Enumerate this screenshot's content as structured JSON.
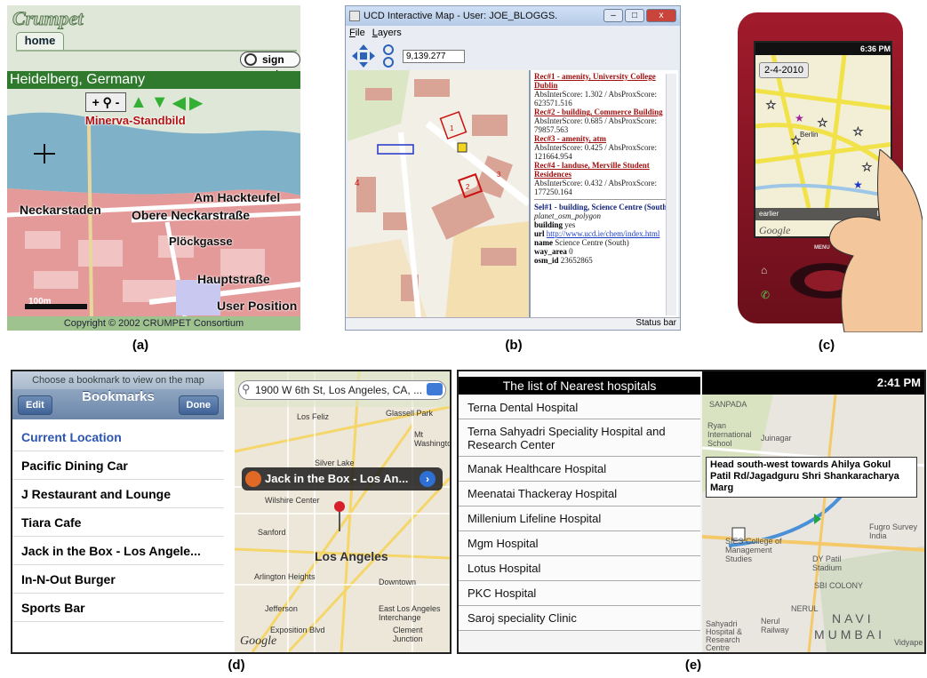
{
  "captions": {
    "a": "(a)",
    "b": "(b)",
    "c": "(c)",
    "d": "(d)",
    "e": "(e)"
  },
  "panel_a": {
    "logo": "Crumpet",
    "tab": "home",
    "sign_out": "sign out",
    "city": "Heidelberg, Germany",
    "poi": "Minerva-Standbild",
    "streets": [
      "Am Hackteufel",
      "Neckarstaden",
      "Obere Neckarstraße",
      "Plöckgasse",
      "Hauptstraße"
    ],
    "scale": "100m",
    "user_position": "User Position",
    "copyright": "Copyright © 2002 CRUMPET Consortium"
  },
  "panel_b": {
    "title": "UCD Interactive Map - User: JOE_BLOGGS.",
    "menu": [
      "File",
      "Layers"
    ],
    "scale_value": "9,139.277",
    "map_markers": [
      "1",
      "2",
      "3",
      "4"
    ],
    "records": [
      {
        "label": "Rec#1 - amenity, University College Dublin",
        "score": "AbsInterScore: 1.302 / AbsProxScore: 623571.516"
      },
      {
        "label": "Rec#2 - building, Commerce Building",
        "score": "AbsInterScore: 0.685 / AbsProxScore: 79857.563"
      },
      {
        "label": "Rec#3 - amenity, atm",
        "score": "AbsInterScore: 0.425 / AbsProxScore: 121664.954"
      },
      {
        "label": "Rec#4 - landuse, Merville Student Residences",
        "score": "AbsInterScore: 0.432 / AbsProxScore: 177250.164"
      }
    ],
    "selection": {
      "label": "Sel#1 - building, Science Centre (South)",
      "table": "planet_osm_polygon",
      "building_key": "building",
      "building_val": "yes",
      "url_key": "url",
      "url_val": "http://www.ucd.ie/chem/index.html",
      "name_key": "name",
      "name_val": "Science Centre (South)",
      "way_key": "way_area",
      "way_val": "0",
      "osm_key": "osm_id",
      "osm_val": "23652865"
    },
    "status": "Status bar"
  },
  "panel_c": {
    "time": "6:36 PM",
    "date": "2-4-2010",
    "city": "Berlin",
    "earlier": "earlier",
    "later": "later",
    "google": "Google",
    "menu": "MENU"
  },
  "panel_d": {
    "hint": "Choose a bookmark to view on the map",
    "edit": "Edit",
    "title": "Bookmarks",
    "done": "Done",
    "bookmarks": [
      "Current Location",
      "Pacific Dining Car",
      "J Restaurant and Lounge",
      "Tiara Cafe",
      "Jack in the Box - Los Angele...",
      "In-N-Out Burger",
      "Sports Bar"
    ],
    "search": "1900 W 6th St, Los Angeles, CA, ...",
    "callout": "Jack in the Box - Los An...",
    "city": "Los Angeles",
    "map_labels": [
      "Los Feliz",
      "Glassell Park",
      "Mt Washington",
      "Silver Lake",
      "Wilshire Center",
      "Sanford",
      "Arlington Heights",
      "Downtown",
      "Jefferson",
      "East Los Angeles Interchange",
      "Exposition Blvd",
      "Clement Junction",
      "Google"
    ]
  },
  "panel_e": {
    "header": "The list of Nearest hospitals",
    "time": "2:41 PM",
    "hospitals": [
      "Terna Dental Hospital",
      "Terna Sahyadri Speciality Hospital and Research Center",
      "Manak Healthcare Hospital",
      "Meenatai Thackeray Hospital",
      "Millenium Lifeline Hospital",
      "Mgm Hospital",
      "Lotus Hospital",
      "PKC Hospital",
      "Saroj speciality Clinic"
    ],
    "direction": "Head south-west towards Ahilya Gokul Patil Rd/Jagadguru Shri Shankaracharya Marg",
    "map_labels": [
      "SANPADA",
      "Ryan International School",
      "Juinagar",
      "Fugro Survey India",
      "SIES College of Management Studies",
      "DY Patil Stadium",
      "SBI COLONY",
      "NERUL",
      "Nerul Railway",
      "Sahyadri Hospital & Research Centre",
      "NAVI",
      "MUMBAI",
      "Vidyape"
    ]
  }
}
